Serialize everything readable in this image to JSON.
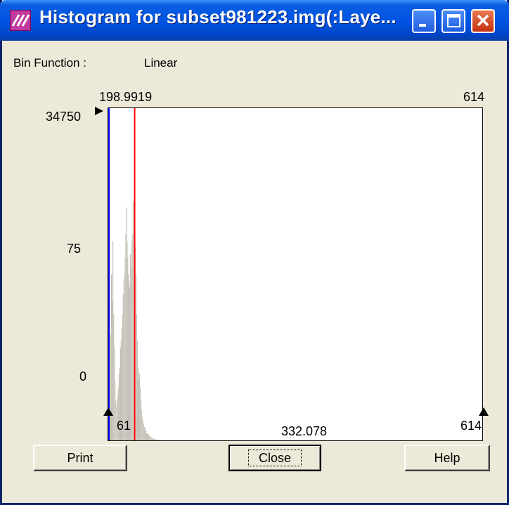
{
  "window": {
    "title": "Histogram for subset981223.img(:Laye..."
  },
  "bin_function": {
    "label": "Bin Function :",
    "value": "Linear"
  },
  "histogram": {
    "top_left_value": "198.9919",
    "top_right_value": "614",
    "y_max": "34750",
    "y_mid": "75",
    "y_min": "0",
    "x_min": "61",
    "x_mid": "332.078",
    "x_max": "614"
  },
  "chart_data": {
    "type": "bar",
    "title": "",
    "xlabel": "",
    "ylabel": "",
    "xlim": [
      61,
      614
    ],
    "x_tick_labels": [
      "61",
      "332.078",
      "614"
    ],
    "y_tick_labels": [
      "34750",
      "75",
      "0"
    ],
    "markers": [
      {
        "name": "blue-line",
        "x": 61,
        "color": "#0000ff"
      },
      {
        "name": "red-line",
        "x": 98.9919,
        "color": "#ff0000"
      }
    ],
    "bins_x": [
      63,
      64,
      65,
      66,
      67,
      68,
      69,
      70,
      71,
      72,
      73,
      74,
      75,
      76,
      77,
      78,
      79,
      80,
      81,
      82,
      83,
      84,
      85,
      86,
      87,
      88,
      89,
      90,
      91,
      92,
      93,
      94,
      95,
      96,
      97,
      98,
      99,
      100,
      101,
      102,
      103,
      104,
      105,
      106,
      107,
      108,
      109,
      110,
      111,
      112,
      113,
      114,
      115,
      116,
      117,
      118,
      119,
      120,
      121,
      122,
      123,
      124,
      125,
      126,
      127,
      128,
      129,
      130,
      131,
      132,
      133,
      134,
      135,
      136,
      137,
      138
    ],
    "bins_norm": [
      0.02,
      0.08,
      0.32,
      0.5,
      0.42,
      0.6,
      0.38,
      0.28,
      0.18,
      0.12,
      0.1,
      0.12,
      0.14,
      0.16,
      0.2,
      0.22,
      0.28,
      0.3,
      0.34,
      0.38,
      0.44,
      0.48,
      0.5,
      0.55,
      0.62,
      0.7,
      0.6,
      0.55,
      0.5,
      0.48,
      0.46,
      0.56,
      0.52,
      0.6,
      0.62,
      0.72,
      0.4,
      0.74,
      0.58,
      0.5,
      0.38,
      0.3,
      0.22,
      0.18,
      0.2,
      0.16,
      0.12,
      0.09,
      0.07,
      0.06,
      0.05,
      0.04,
      0.04,
      0.03,
      0.03,
      0.02,
      0.02,
      0.02,
      0.015,
      0.015,
      0.01,
      0.01,
      0.01,
      0.008,
      0.006,
      0.005,
      0.004,
      0.004,
      0.003,
      0.003,
      0.002,
      0.002,
      0.002,
      0.001,
      0.001,
      0.001
    ],
    "colors": {
      "bar": "#808080",
      "outline": "#e8e4d8"
    }
  }
}
